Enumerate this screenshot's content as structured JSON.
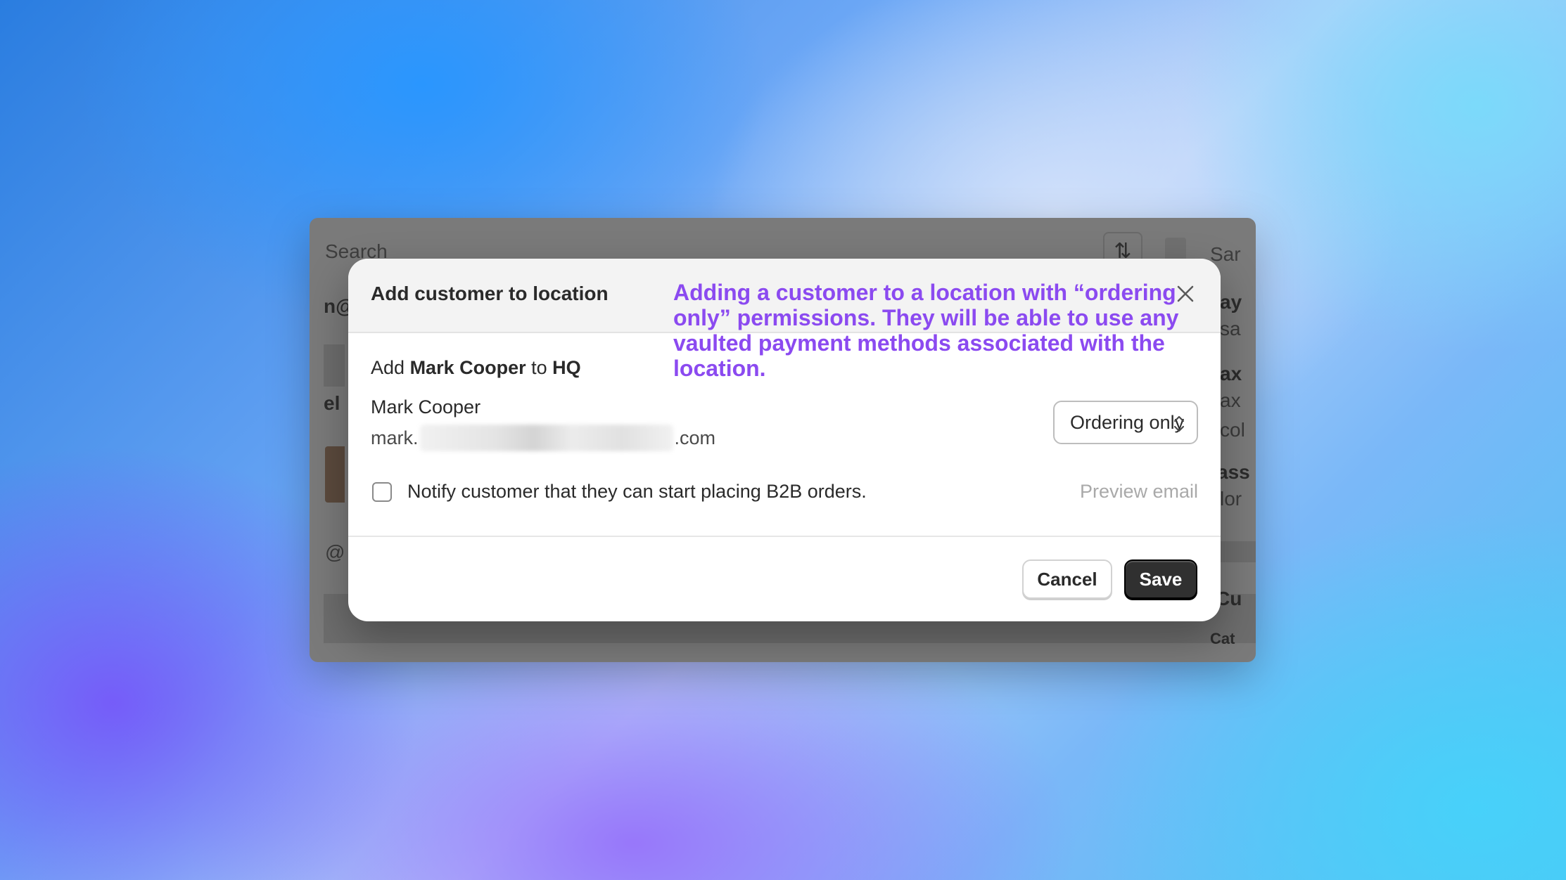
{
  "background_app": {
    "search_placeholder": "Search",
    "frag_email": "n@",
    "frag_name": "el",
    "frag_at": "@",
    "frag_sar": "Sar",
    "frag_ay": "ay",
    "frag_sa": "sa",
    "frag_ax1": "ax",
    "frag_ax2": "ax",
    "frag_col": "col",
    "frag_ass": "ass",
    "frag_lor": "lor",
    "frag_cu": "Cu",
    "frag_cat": "Cat"
  },
  "modal": {
    "title": "Add customer to location",
    "annotation": "Adding a customer to a location with “ordering only” permissions.  They will be able to use any vaulted payment methods associated with the location.",
    "add_prefix": "Add",
    "customer_name_bold": "Mark Cooper",
    "to_word": "to",
    "location_name": "HQ",
    "customer_name": "Mark Cooper",
    "email_start": "mark.",
    "email_end": ".com",
    "permission_select_value": "Ordering only",
    "notify_label": "Notify customer that they can start placing B2B orders.",
    "notify_checked": false,
    "preview_link": "Preview email",
    "cancel_label": "Cancel",
    "save_label": "Save"
  },
  "colors": {
    "annotation": "#8b4af0",
    "save_button": "#303030"
  }
}
